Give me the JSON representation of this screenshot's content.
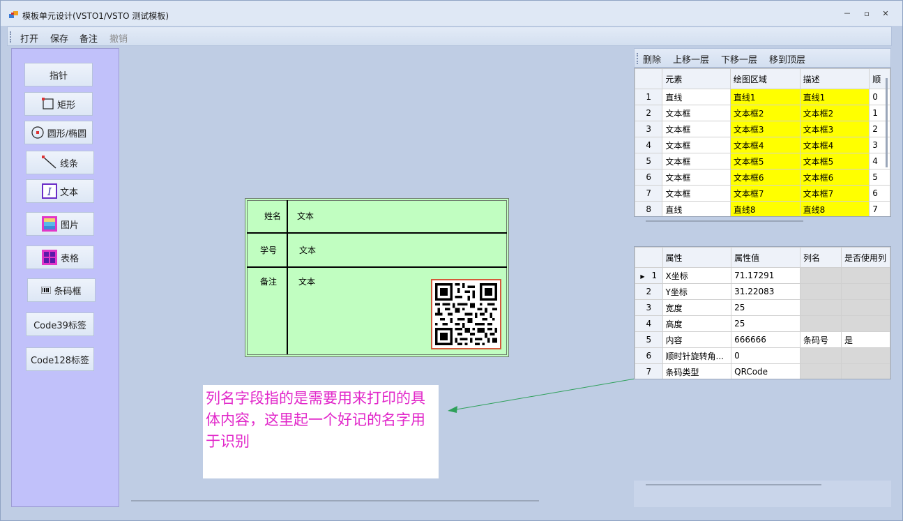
{
  "window": {
    "title": "模板单元设计(VSTO1/VSTO 测试模板)",
    "controls": [
      "－",
      "▫",
      "✕"
    ]
  },
  "menu": {
    "items": [
      {
        "label": "打开",
        "enabled": true
      },
      {
        "label": "保存",
        "enabled": true
      },
      {
        "label": "备注",
        "enabled": true
      },
      {
        "label": "撤销",
        "enabled": false
      }
    ]
  },
  "toolbox": {
    "buttons": [
      {
        "label": "指针",
        "icon": "pointer-icon"
      },
      {
        "label": "矩形",
        "icon": "rectangle-icon"
      },
      {
        "label": "圆形/椭圆",
        "icon": "ellipse-icon"
      },
      {
        "label": "线条",
        "icon": "line-icon"
      },
      {
        "label": "文本",
        "icon": "text-icon"
      },
      {
        "label": "图片",
        "icon": "image-icon"
      },
      {
        "label": "表格",
        "icon": "table-icon"
      },
      {
        "label": "条码框",
        "icon": "barcode-icon"
      },
      {
        "label": "Code39标签",
        "icon": ""
      },
      {
        "label": "Code128标签",
        "icon": ""
      }
    ]
  },
  "card": {
    "rows": [
      {
        "label": "姓名",
        "value": "文本"
      },
      {
        "label": "学号",
        "value": "文本"
      },
      {
        "label": "备注",
        "value": "文本"
      }
    ],
    "qr_icon": "qr-code-icon",
    "colors": {
      "background": "#c1fec1",
      "qr_border": "#d4593b"
    }
  },
  "note": {
    "text": "列名字段指的是需要用来打印的具体内容，这里起一个好记的名字用于识别",
    "color": "#e126c9",
    "arrow_color": "#2ea05a"
  },
  "right_toolbar": {
    "items": [
      "删除",
      "上移一层",
      "下移一层",
      "移到顶层"
    ]
  },
  "elements_grid": {
    "columns": [
      "元素",
      "绘图区域",
      "描述",
      "顺"
    ],
    "rows": [
      {
        "n": "1",
        "element": "直线",
        "area": "直线1",
        "desc": "直线1",
        "order": "0"
      },
      {
        "n": "2",
        "element": "文本框",
        "area": "文本框2",
        "desc": "文本框2",
        "order": "1"
      },
      {
        "n": "3",
        "element": "文本框",
        "area": "文本框3",
        "desc": "文本框3",
        "order": "2"
      },
      {
        "n": "4",
        "element": "文本框",
        "area": "文本框4",
        "desc": "文本框4",
        "order": "3"
      },
      {
        "n": "5",
        "element": "文本框",
        "area": "文本框5",
        "desc": "文本框5",
        "order": "4"
      },
      {
        "n": "6",
        "element": "文本框",
        "area": "文本框6",
        "desc": "文本框6",
        "order": "5"
      },
      {
        "n": "7",
        "element": "文本框",
        "area": "文本框7",
        "desc": "文本框7",
        "order": "6"
      },
      {
        "n": "8",
        "element": "直线",
        "area": "直线8",
        "desc": "直线8",
        "order": "7"
      }
    ],
    "highlight_color": "#ffff00"
  },
  "props_grid": {
    "columns": [
      "属性",
      "属性值",
      "列名",
      "是否使用列"
    ],
    "rows": [
      {
        "n": "1",
        "prop": "X坐标",
        "value": "71.17291",
        "col": "",
        "use": "",
        "current": true
      },
      {
        "n": "2",
        "prop": "Y坐标",
        "value": "31.22083",
        "col": "",
        "use": ""
      },
      {
        "n": "3",
        "prop": "宽度",
        "value": "25",
        "col": "",
        "use": ""
      },
      {
        "n": "4",
        "prop": "高度",
        "value": "25",
        "col": "",
        "use": ""
      },
      {
        "n": "5",
        "prop": "内容",
        "value": "666666",
        "col": "条码号",
        "use": "是"
      },
      {
        "n": "6",
        "prop": "顺时针旋转角...",
        "value": "0",
        "col": "",
        "use": ""
      },
      {
        "n": "7",
        "prop": "条码类型",
        "value": "QRCode",
        "col": "",
        "use": ""
      }
    ]
  }
}
